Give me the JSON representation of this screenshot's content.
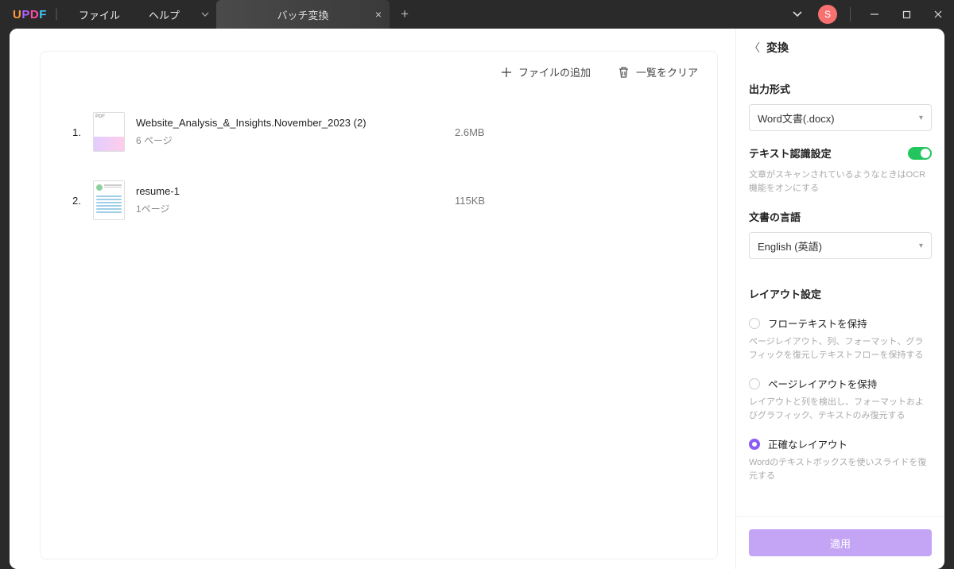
{
  "titlebar": {
    "menus": {
      "file": "ファイル",
      "help": "ヘルプ"
    },
    "tab_label": "バッチ変換",
    "avatar_initial": "S"
  },
  "toolbar": {
    "add_files": "ファイルの追加",
    "clear_list": "一覧をクリア"
  },
  "files": [
    {
      "idx": "1.",
      "name": "Website_Analysis_&_Insights.November_2023 (2)",
      "pages": "6 ページ",
      "size": "2.6MB",
      "thumb_label": "PDF"
    },
    {
      "idx": "2.",
      "name": "resume-1",
      "pages": "1ページ",
      "size": "115KB",
      "thumb_label": ""
    }
  ],
  "side": {
    "title": "変換",
    "output_format_label": "出力形式",
    "output_format_value": "Word文書(.docx)",
    "ocr_label": "テキスト認識設定",
    "ocr_hint": "文章がスキャンされているようなときはOCR機能をオンにする",
    "lang_label": "文書の言語",
    "lang_value": "English (英語)",
    "layout_label": "レイアウト設定",
    "layout_options": [
      {
        "label": "フローテキストを保持",
        "desc": "ページレイアウト、列、フォーマット、グラフィックを復元しテキストフローを保持する",
        "selected": false
      },
      {
        "label": "ページレイアウトを保持",
        "desc": "レイアウトと列を検出し、フォーマットおよびグラフィック、テキストのみ復元する",
        "selected": false
      },
      {
        "label": "正確なレイアウト",
        "desc": "Wordのテキストボックスを使いスライドを復元する",
        "selected": true
      }
    ],
    "apply": "適用"
  }
}
